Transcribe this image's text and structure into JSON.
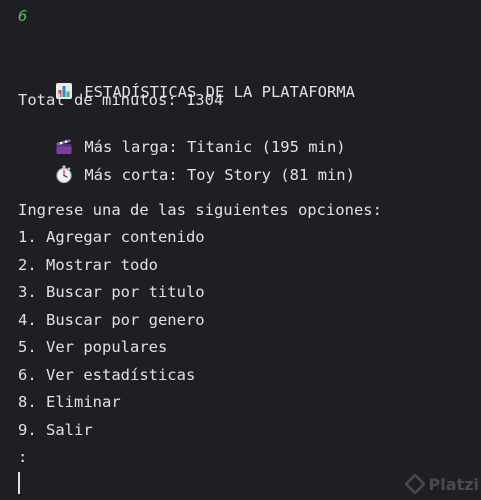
{
  "console": {
    "input_echo": "6",
    "stats": {
      "header_icon": "bar-chart-emoji",
      "header": "ESTADÍSTICAS DE LA PLATAFORMA",
      "total": "Total de minutos: 1304",
      "longest_icon": "clapper-board-emoji",
      "longest": "Más larga: Titanic (195 min)",
      "shortest_icon": "stopwatch-emoji",
      "shortest": "Más corta: Toy Story (81 min)"
    },
    "menu": {
      "prompt": "Ingrese una de las siguientes opciones:",
      "options": [
        "1. Agregar contenido",
        "2. Mostrar todo",
        "3. Buscar por titulo",
        "4. Buscar por genero",
        "5. Ver populares",
        "6. Ver estadísticas",
        "8. Eliminar",
        "9. Salir"
      ],
      "input_prompt": ":"
    }
  },
  "watermark": {
    "text": "Platzi",
    "icon": "platzi-logo-icon"
  },
  "colors": {
    "background": "#1e1f22",
    "text": "#dfe1e5",
    "input_echo": "#5fb865"
  }
}
